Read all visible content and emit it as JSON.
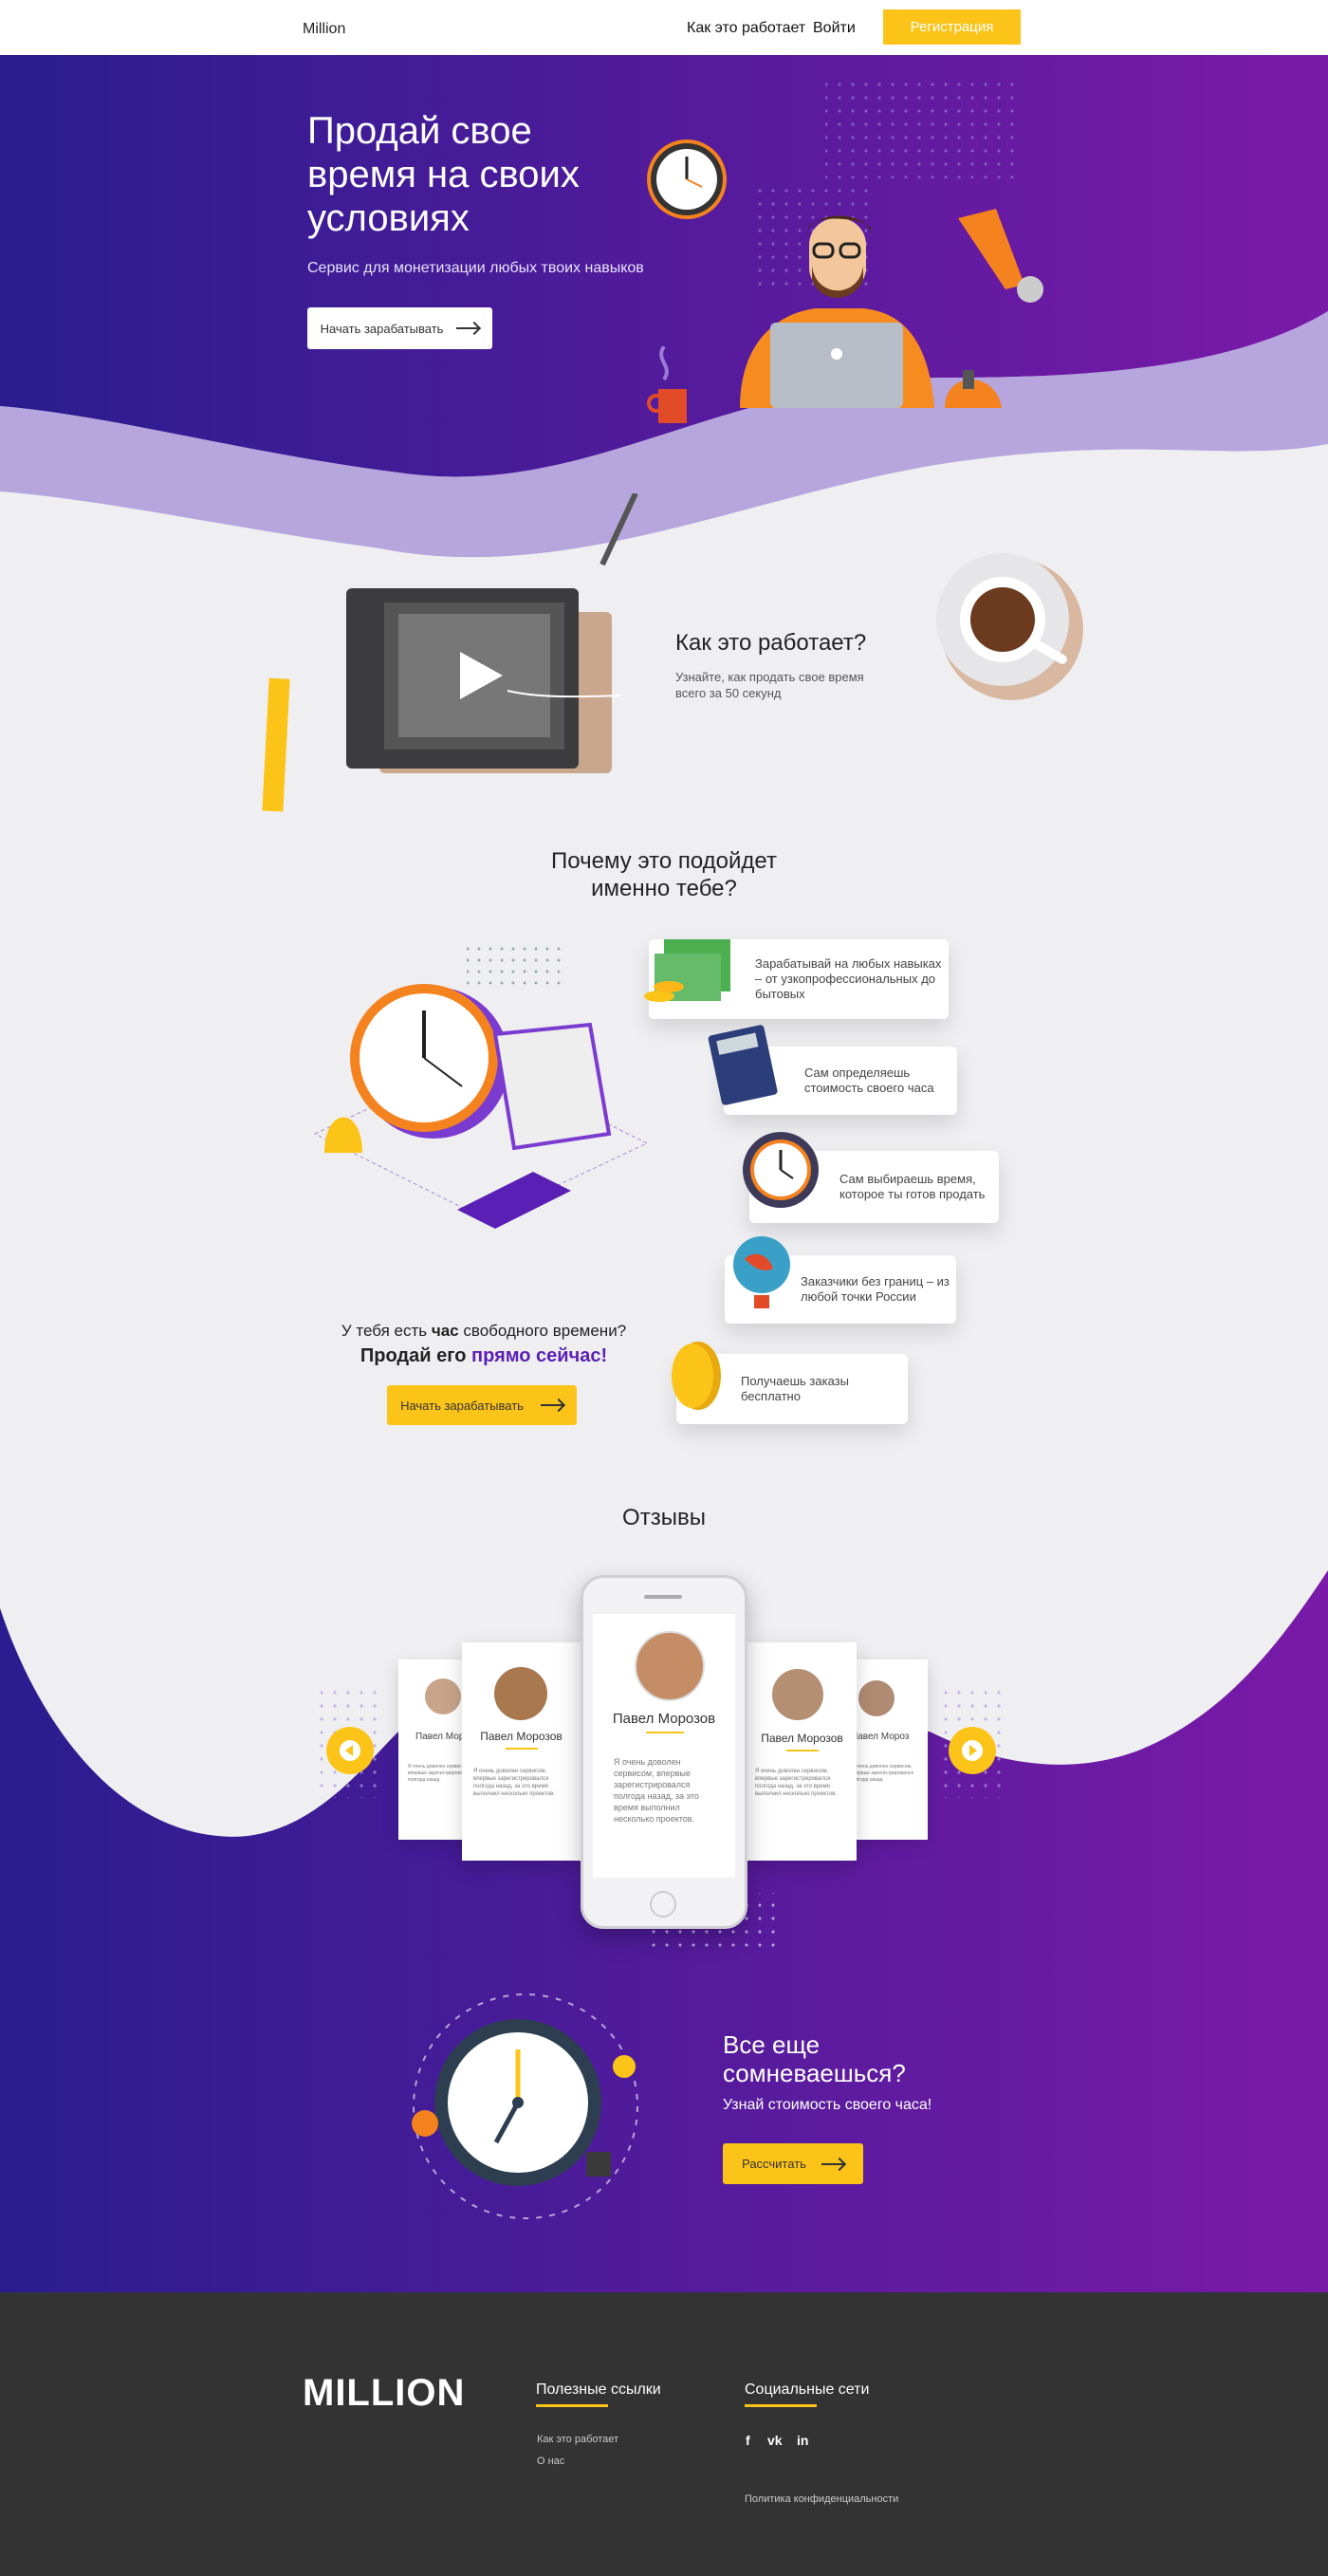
{
  "header": {
    "logo": "Million",
    "nav_how": "Как это работает",
    "nav_login": "Войти",
    "register": "Регистрация"
  },
  "hero": {
    "title": "Продай свое время на своих условиях",
    "subtitle": "Сервис для монетизации любых твоих  навыков",
    "button": "Начать зарабатывать"
  },
  "how": {
    "title": "Как это работает?",
    "subtitle": "Узнайте, как продать  свое время всего за 50 секунд"
  },
  "why": {
    "title": "Почему это подойдет именно тебе?",
    "features": [
      "Зарабатывай на любых навыках – от узкопрофессиональных до бытовых",
      "Сам определяешь стоимость своего часа",
      "Сам выбираешь время, которое ты готов продать",
      "Заказчики без границ – из любой точки России",
      "Получаешь заказы бесплатно"
    ],
    "free_time_before": "У тебя есть ",
    "free_time_bold": "час",
    "free_time_after": " свободного времени?",
    "sell_now_plain": "Продай его ",
    "sell_now_accent": "прямо сейчас!",
    "button": "Начать зарабатывать"
  },
  "reviews": {
    "title": "Отзывы",
    "items": [
      {
        "name": "Павел Мороз",
        "text": "Я очень доволен сервисом, впервые зарегистрировался полгода назад"
      },
      {
        "name": "Павел Морозов",
        "text": "Я очень доволен сервисом, впервые зарегистрировался полгода назад, за это время выполнил несколько проектов."
      },
      {
        "name": "Павел Морозов",
        "text": "Я очень доволен сервисом, впервые зарегистрировался полгода назад, за это время выполнил несколько проектов."
      },
      {
        "name": "Павел Морозов",
        "text": "Я очень доволен сервисом, впервые зарегистрировался полгода назад, за это время выполнил несколько проектов."
      },
      {
        "name": "Павел Мороз",
        "text": "Я очень доволен сервисом, впервые зарегистрировался полгода назад"
      }
    ]
  },
  "doubt": {
    "title": "Все еще сомневаешься?",
    "subtitle": "Узнай стоимость своего часа!",
    "button": "Рассчитать"
  },
  "footer": {
    "logo": "MILLION",
    "links_title": "Полезные ссылки",
    "links": [
      "Как это работает",
      "О нас"
    ],
    "social_title": "Социальные сети",
    "social": [
      "f",
      "vk",
      "in"
    ],
    "privacy": "Политика конфиденциальности"
  },
  "colors": {
    "accent": "#fcc418",
    "purple_dark": "#2a1c8f",
    "purple_light": "#7a1aa8",
    "footer": "#333333"
  }
}
